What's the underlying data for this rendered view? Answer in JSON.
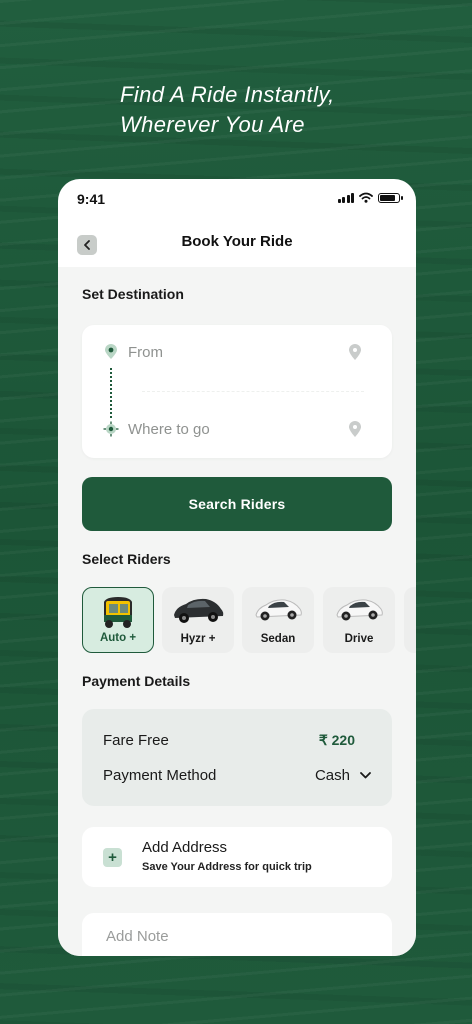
{
  "headline": {
    "line1": "Find A Ride Instantly,",
    "line2": "Wherever You Are"
  },
  "status_bar": {
    "time": "9:41",
    "battery_level": 0.85
  },
  "header": {
    "title": "Book Your Ride"
  },
  "destination": {
    "section_title": "Set Destination",
    "from_placeholder": "From",
    "to_placeholder": "Where to go"
  },
  "search_button": {
    "label": "Search Riders"
  },
  "riders": {
    "section_title": "Select Riders",
    "items": [
      {
        "label": "Auto +",
        "icon": "auto-rickshaw-icon",
        "selected": true
      },
      {
        "label": "Hyzr +",
        "icon": "car-dark-icon",
        "selected": false
      },
      {
        "label": "Sedan",
        "icon": "car-white-icon",
        "selected": false
      },
      {
        "label": "Drive",
        "icon": "car-white-icon",
        "selected": false
      }
    ]
  },
  "payment": {
    "section_title": "Payment Details",
    "fare_label": "Fare Free",
    "fare_value": "₹ 220",
    "method_label": "Payment Method",
    "method_value": "Cash"
  },
  "address": {
    "title": "Add Address",
    "subtitle": "Save Your Address for quick trip"
  },
  "note": {
    "placeholder": "Add Note"
  },
  "colors": {
    "brand": "#1f5a3b",
    "background": "#1f5a3b",
    "selected_rider_bg": "#d7ece0"
  }
}
